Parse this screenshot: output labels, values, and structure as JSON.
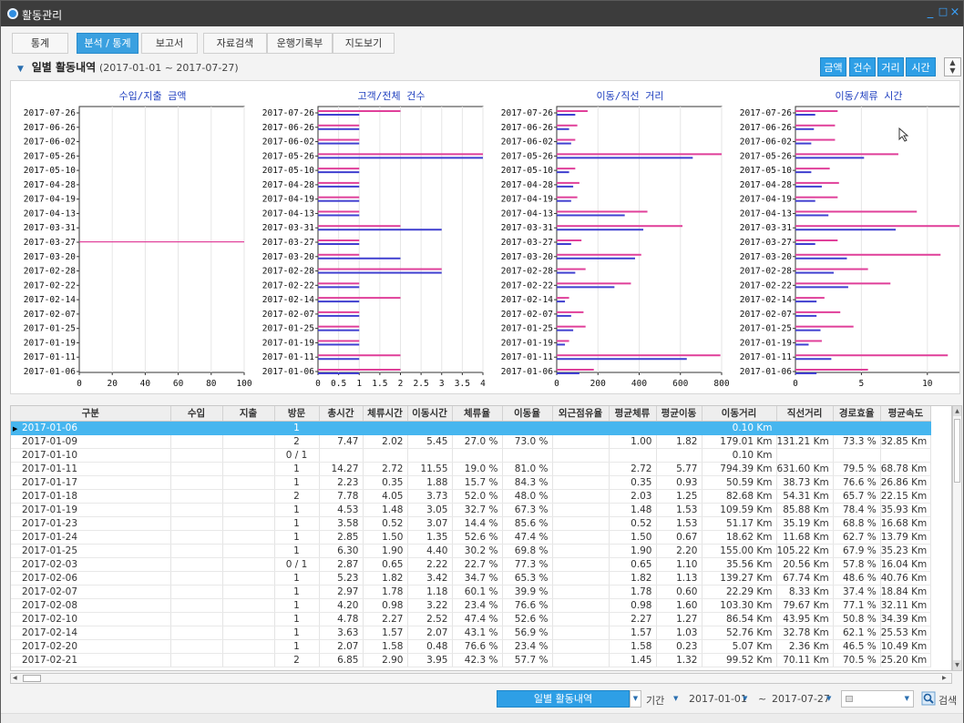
{
  "window": {
    "title": "활동관리",
    "min": "_",
    "max": "□",
    "close": "×"
  },
  "tabs": [
    {
      "label": "통계",
      "active": false
    },
    {
      "label": "분석 / 통계",
      "active": true
    },
    {
      "label": "보고서",
      "active": false
    },
    {
      "label": "자료검색",
      "active": false
    },
    {
      "label": "운행기록부",
      "active": false
    },
    {
      "label": "지도보기",
      "active": false
    }
  ],
  "section": {
    "title": "일별 활동내역",
    "range": "(2017-01-01 ~ 2017-07-27)"
  },
  "toolbar": {
    "btn_amount": "금액",
    "btn_count": "건수",
    "btn_distance": "거리",
    "btn_time": "시간"
  },
  "colors": {
    "accent": "#2e9fe6",
    "series_pink": "#e0409a",
    "series_blue": "#4040d0",
    "selected_row": "#46b6ef"
  },
  "chart_data": [
    {
      "type": "bar",
      "orientation": "horizontal",
      "title": "수입/지출 금액",
      "categories": [
        "2017-07-26",
        "2017-06-26",
        "2017-06-02",
        "2017-05-26",
        "2017-05-10",
        "2017-04-28",
        "2017-04-19",
        "2017-04-13",
        "2017-03-31",
        "2017-03-27",
        "2017-03-20",
        "2017-02-28",
        "2017-02-22",
        "2017-02-14",
        "2017-02-07",
        "2017-01-25",
        "2017-01-19",
        "2017-01-11",
        "2017-01-06"
      ],
      "xlim": [
        0,
        100
      ],
      "xticks": [
        "0",
        "20",
        "40",
        "60",
        "80",
        "100"
      ],
      "series": [
        {
          "values": [
            0,
            0,
            0,
            0,
            0,
            0,
            0,
            0,
            0,
            100,
            0,
            0,
            0,
            0,
            0,
            0,
            0,
            0,
            0
          ]
        }
      ]
    },
    {
      "type": "bar",
      "orientation": "horizontal",
      "title": "고객/전체 건수",
      "categories": [
        "2017-07-26",
        "2017-06-26",
        "2017-06-02",
        "2017-05-26",
        "2017-05-10",
        "2017-04-28",
        "2017-04-19",
        "2017-04-13",
        "2017-03-31",
        "2017-03-27",
        "2017-03-20",
        "2017-02-28",
        "2017-02-22",
        "2017-02-14",
        "2017-02-07",
        "2017-01-25",
        "2017-01-19",
        "2017-01-11",
        "2017-01-06"
      ],
      "xlim": [
        0,
        4
      ],
      "xticks": [
        "0",
        "0.5",
        "1",
        "1.5",
        "2",
        "2.5",
        "3",
        "3.5",
        "4"
      ],
      "series": [
        {
          "values": [
            2,
            1,
            1,
            4,
            1,
            1,
            1,
            1,
            2,
            1,
            1,
            3,
            1,
            2,
            1,
            1,
            1,
            2,
            2
          ]
        },
        {
          "values": [
            1,
            1,
            1,
            4,
            1,
            1,
            1,
            1,
            3,
            1,
            2,
            3,
            1,
            1,
            1,
            1,
            1,
            1,
            1
          ]
        }
      ]
    },
    {
      "type": "bar",
      "orientation": "horizontal",
      "title": "이동/직선 거리",
      "categories": [
        "2017-07-26",
        "2017-06-26",
        "2017-06-02",
        "2017-05-26",
        "2017-05-10",
        "2017-04-28",
        "2017-04-19",
        "2017-04-13",
        "2017-03-31",
        "2017-03-27",
        "2017-03-20",
        "2017-02-28",
        "2017-02-22",
        "2017-02-14",
        "2017-02-07",
        "2017-01-25",
        "2017-01-19",
        "2017-01-11",
        "2017-01-06"
      ],
      "xlim": [
        0,
        800
      ],
      "xticks": [
        "0",
        "200",
        "400",
        "600",
        "800"
      ],
      "series": [
        {
          "values": [
            150,
            100,
            90,
            830,
            90,
            110,
            100,
            440,
            610,
            120,
            410,
            140,
            360,
            60,
            130,
            140,
            60,
            794,
            180
          ]
        },
        {
          "values": [
            90,
            60,
            70,
            660,
            60,
            80,
            70,
            330,
            420,
            70,
            380,
            90,
            280,
            40,
            70,
            80,
            40,
            631,
            110
          ]
        }
      ]
    },
    {
      "type": "bar",
      "orientation": "horizontal",
      "title": "이동/체류 시간",
      "categories": [
        "2017-07-26",
        "2017-06-26",
        "2017-06-02",
        "2017-05-26",
        "2017-05-10",
        "2017-04-28",
        "2017-04-19",
        "2017-04-13",
        "2017-03-31",
        "2017-03-27",
        "2017-03-20",
        "2017-02-28",
        "2017-02-22",
        "2017-02-14",
        "2017-02-07",
        "2017-01-25",
        "2017-01-19",
        "2017-01-11",
        "2017-01-06"
      ],
      "xlim": [
        0,
        12.5
      ],
      "xticks": [
        "0",
        "5",
        "10"
      ],
      "series": [
        {
          "values": [
            3.2,
            3.0,
            3.0,
            7.8,
            2.6,
            3.3,
            3.2,
            9.2,
            13.0,
            3.2,
            11.0,
            5.5,
            7.2,
            2.2,
            3.4,
            4.4,
            2.0,
            11.55,
            5.5
          ]
        },
        {
          "values": [
            1.5,
            1.4,
            1.2,
            5.2,
            1.2,
            2.0,
            1.5,
            2.5,
            7.6,
            1.5,
            3.9,
            2.9,
            4.0,
            1.6,
            1.6,
            1.9,
            1.0,
            2.72,
            1.6
          ]
        }
      ]
    }
  ],
  "table": {
    "headers": [
      "구분",
      "수입",
      "지출",
      "방문",
      "총시간",
      "체류시간",
      "이동시간",
      "체류율",
      "이동율",
      "외근점유율",
      "평균체류",
      "평균이동",
      "이동거리",
      "직선거리",
      "경로효율",
      "평균속도"
    ],
    "rows": [
      [
        "2017-01-06",
        "",
        "",
        "1",
        "",
        "",
        "",
        "",
        "",
        "",
        "",
        "",
        "0.10 Km",
        "",
        "",
        ""
      ],
      [
        "2017-01-09",
        "",
        "",
        "2",
        "7.47",
        "2.02",
        "5.45",
        "27.0 %",
        "73.0 %",
        "",
        "1.00",
        "1.82",
        "179.01 Km",
        "131.21 Km",
        "73.3 %",
        "32.85 Km"
      ],
      [
        "2017-01-10",
        "",
        "",
        "0 / 1",
        "",
        "",
        "",
        "",
        "",
        "",
        "",
        "",
        "0.10 Km",
        "",
        "",
        ""
      ],
      [
        "2017-01-11",
        "",
        "",
        "1",
        "14.27",
        "2.72",
        "11.55",
        "19.0 %",
        "81.0 %",
        "",
        "2.72",
        "5.77",
        "794.39 Km",
        "631.60 Km",
        "79.5 %",
        "68.78 Km"
      ],
      [
        "2017-01-17",
        "",
        "",
        "1",
        "2.23",
        "0.35",
        "1.88",
        "15.7 %",
        "84.3 %",
        "",
        "0.35",
        "0.93",
        "50.59 Km",
        "38.73 Km",
        "76.6 %",
        "26.86 Km"
      ],
      [
        "2017-01-18",
        "",
        "",
        "2",
        "7.78",
        "4.05",
        "3.73",
        "52.0 %",
        "48.0 %",
        "",
        "2.03",
        "1.25",
        "82.68 Km",
        "54.31 Km",
        "65.7 %",
        "22.15 Km"
      ],
      [
        "2017-01-19",
        "",
        "",
        "1",
        "4.53",
        "1.48",
        "3.05",
        "32.7 %",
        "67.3 %",
        "",
        "1.48",
        "1.53",
        "109.59 Km",
        "85.88 Km",
        "78.4 %",
        "35.93 Km"
      ],
      [
        "2017-01-23",
        "",
        "",
        "1",
        "3.58",
        "0.52",
        "3.07",
        "14.4 %",
        "85.6 %",
        "",
        "0.52",
        "1.53",
        "51.17 Km",
        "35.19 Km",
        "68.8 %",
        "16.68 Km"
      ],
      [
        "2017-01-24",
        "",
        "",
        "1",
        "2.85",
        "1.50",
        "1.35",
        "52.6 %",
        "47.4 %",
        "",
        "1.50",
        "0.67",
        "18.62 Km",
        "11.68 Km",
        "62.7 %",
        "13.79 Km"
      ],
      [
        "2017-01-25",
        "",
        "",
        "1",
        "6.30",
        "1.90",
        "4.40",
        "30.2 %",
        "69.8 %",
        "",
        "1.90",
        "2.20",
        "155.00 Km",
        "105.22 Km",
        "67.9 %",
        "35.23 Km"
      ],
      [
        "2017-02-03",
        "",
        "",
        "0 / 1",
        "2.87",
        "0.65",
        "2.22",
        "22.7 %",
        "77.3 %",
        "",
        "0.65",
        "1.10",
        "35.56 Km",
        "20.56 Km",
        "57.8 %",
        "16.04 Km"
      ],
      [
        "2017-02-06",
        "",
        "",
        "1",
        "5.23",
        "1.82",
        "3.42",
        "34.7 %",
        "65.3 %",
        "",
        "1.82",
        "1.13",
        "139.27 Km",
        "67.74 Km",
        "48.6 %",
        "40.76 Km"
      ],
      [
        "2017-02-07",
        "",
        "",
        "1",
        "2.97",
        "1.78",
        "1.18",
        "60.1 %",
        "39.9 %",
        "",
        "1.78",
        "0.60",
        "22.29 Km",
        "8.33 Km",
        "37.4 %",
        "18.84 Km"
      ],
      [
        "2017-02-08",
        "",
        "",
        "1",
        "4.20",
        "0.98",
        "3.22",
        "23.4 %",
        "76.6 %",
        "",
        "0.98",
        "1.60",
        "103.30 Km",
        "79.67 Km",
        "77.1 %",
        "32.11 Km"
      ],
      [
        "2017-02-10",
        "",
        "",
        "1",
        "4.78",
        "2.27",
        "2.52",
        "47.4 %",
        "52.6 %",
        "",
        "2.27",
        "1.27",
        "86.54 Km",
        "43.95 Km",
        "50.8 %",
        "34.39 Km"
      ],
      [
        "2017-02-14",
        "",
        "",
        "1",
        "3.63",
        "1.57",
        "2.07",
        "43.1 %",
        "56.9 %",
        "",
        "1.57",
        "1.03",
        "52.76 Km",
        "32.78 Km",
        "62.1 %",
        "25.53 Km"
      ],
      [
        "2017-02-20",
        "",
        "",
        "1",
        "2.07",
        "1.58",
        "0.48",
        "76.6 %",
        "23.4 %",
        "",
        "1.58",
        "0.23",
        "5.07 Km",
        "2.36 Km",
        "46.5 %",
        "10.49 Km"
      ],
      [
        "2017-02-21",
        "",
        "",
        "2",
        "6.85",
        "2.90",
        "3.95",
        "42.3 %",
        "57.7 %",
        "",
        "1.45",
        "1.32",
        "99.52 Km",
        "70.11 Km",
        "70.5 %",
        "25.20 Km"
      ]
    ]
  },
  "footer": {
    "view_select": "일별 활동내역",
    "period_label": "기간",
    "date_from": "2017-01-01",
    "tilde": "~",
    "date_to": "2017-07-27",
    "search_label": "검색"
  }
}
